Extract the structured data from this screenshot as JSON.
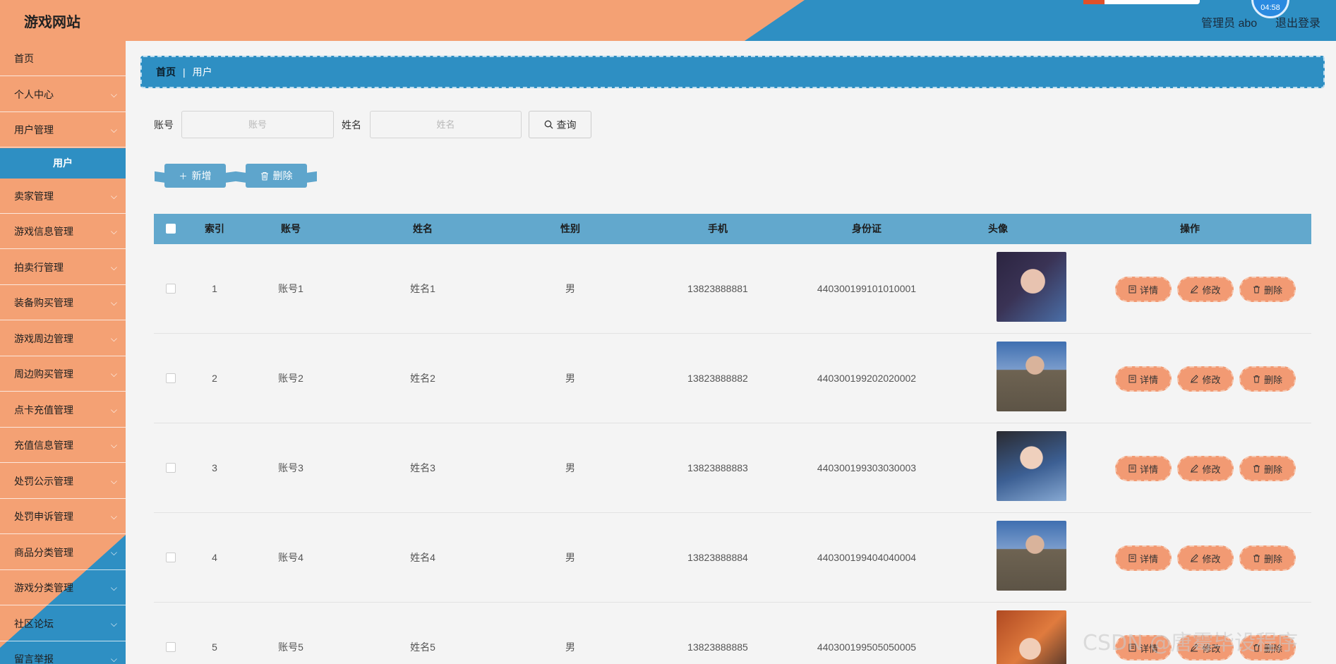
{
  "header": {
    "brand": "游戏网站",
    "clock": "04:58",
    "user": "管理员 abo",
    "logout": "退出登录"
  },
  "sidebar": {
    "items": [
      {
        "label": "首页",
        "expandable": false
      },
      {
        "label": "个人中心",
        "expandable": true
      },
      {
        "label": "用户管理",
        "expandable": true
      },
      {
        "label": "用户",
        "sub": true
      },
      {
        "label": "卖家管理",
        "expandable": true
      },
      {
        "label": "游戏信息管理",
        "expandable": true
      },
      {
        "label": "拍卖行管理",
        "expandable": true
      },
      {
        "label": "装备购买管理",
        "expandable": true
      },
      {
        "label": "游戏周边管理",
        "expandable": true
      },
      {
        "label": "周边购买管理",
        "expandable": true
      },
      {
        "label": "点卡充值管理",
        "expandable": true
      },
      {
        "label": "充值信息管理",
        "expandable": true
      },
      {
        "label": "处罚公示管理",
        "expandable": true
      },
      {
        "label": "处罚申诉管理",
        "expandable": true
      },
      {
        "label": "商品分类管理",
        "expandable": true
      },
      {
        "label": "游戏分类管理",
        "expandable": true
      },
      {
        "label": "社区论坛",
        "expandable": true
      },
      {
        "label": "留言举报",
        "expandable": true
      }
    ]
  },
  "breadcrumb": {
    "home": "首页",
    "separator": "|",
    "current": "用户"
  },
  "search": {
    "account_label": "账号",
    "account_placeholder": "账号",
    "name_label": "姓名",
    "name_placeholder": "姓名",
    "query_button": "查询"
  },
  "actions": {
    "add": "新增",
    "delete": "删除"
  },
  "table": {
    "columns": [
      "索引",
      "账号",
      "姓名",
      "性别",
      "手机",
      "身份证",
      "头像",
      "操作"
    ],
    "rows": [
      {
        "index": "1",
        "account": "账号1",
        "name": "姓名1",
        "gender": "男",
        "phone": "13823888881",
        "id_card": "440300199101010001",
        "avatar": "photo-woman-dark-hair"
      },
      {
        "index": "2",
        "account": "账号2",
        "name": "姓名2",
        "gender": "男",
        "phone": "13823888882",
        "id_card": "440300199202020002",
        "avatar": "photo-man-cap"
      },
      {
        "index": "3",
        "account": "账号3",
        "name": "姓名3",
        "gender": "男",
        "phone": "13823888883",
        "id_card": "440300199303030003",
        "avatar": "photo-man-denim"
      },
      {
        "index": "4",
        "account": "账号4",
        "name": "姓名4",
        "gender": "男",
        "phone": "13823888884",
        "id_card": "440300199404040004",
        "avatar": "photo-man-cap"
      },
      {
        "index": "5",
        "account": "账号5",
        "name": "姓名5",
        "gender": "男",
        "phone": "13823888885",
        "id_card": "440300199505050005",
        "avatar": "photo-woman-warm"
      }
    ],
    "row_actions": {
      "detail": "详情",
      "edit": "修改",
      "delete": "删除"
    }
  },
  "watermark": "CSDN @唐霉毕设程序",
  "colors": {
    "orange": "#f4a174",
    "blue": "#2e8fc3",
    "table_header": "#62a8cd",
    "op_button": "#f29a73"
  },
  "icons": {
    "chevron": "chevron-down-icon",
    "search": "search-icon",
    "plus": "plus-icon",
    "trash": "trash-icon",
    "detail": "document-icon",
    "edit": "pencil-icon"
  }
}
